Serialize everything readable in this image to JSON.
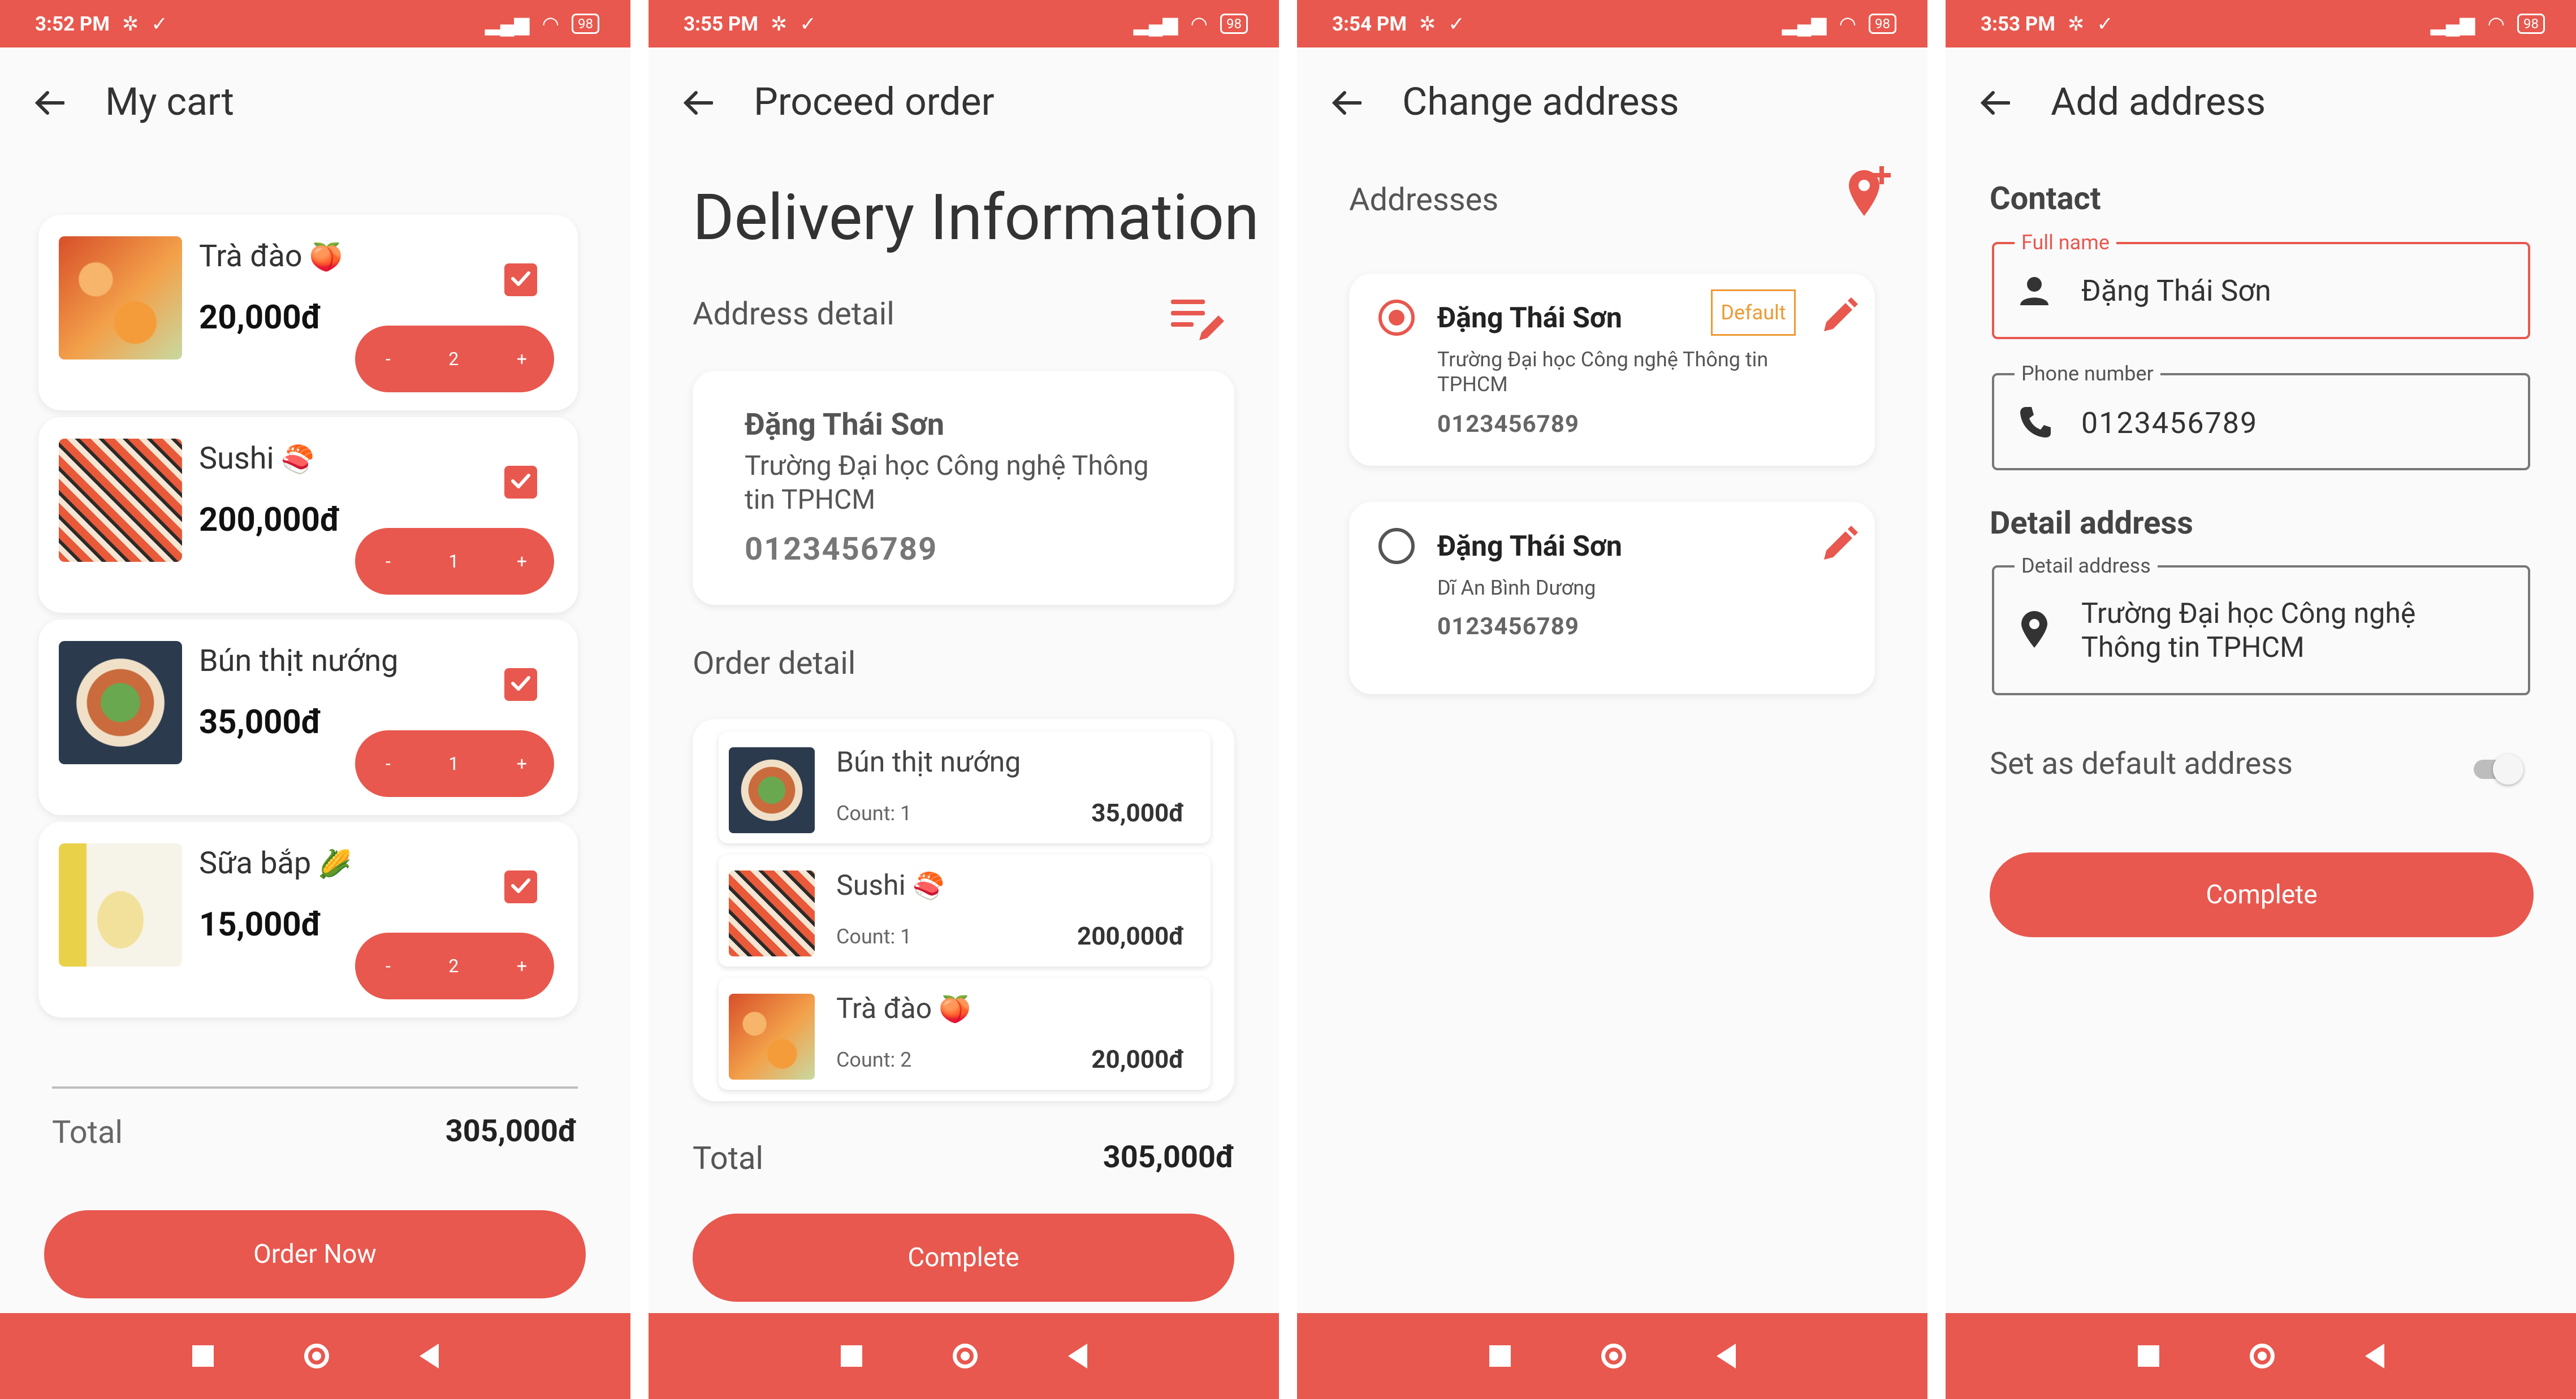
{
  "colors": {
    "accent": "#E8584E",
    "text": "#333333",
    "muted": "#666666",
    "default_badge": "#EF9A34"
  },
  "status_bars": [
    {
      "time": "3:52 PM",
      "battery": "98"
    },
    {
      "time": "3:55 PM",
      "battery": "98"
    },
    {
      "time": "3:54 PM",
      "battery": "98"
    },
    {
      "time": "3:53 PM",
      "battery": "98"
    }
  ],
  "cart": {
    "title": "My cart",
    "items": [
      {
        "name": "Trà đào",
        "emoji": "🍑",
        "price": "20,000đ",
        "qty": "2",
        "minus": "-",
        "plus": "+",
        "image": "peach-tea-photo",
        "checked": true
      },
      {
        "name": "Sushi",
        "emoji": "🍣",
        "price": "200,000đ",
        "qty": "1",
        "minus": "-",
        "plus": "+",
        "image": "sushi-photo",
        "checked": true
      },
      {
        "name": "Bún thịt nướng",
        "emoji": "",
        "price": "35,000đ",
        "qty": "1",
        "minus": "-",
        "plus": "+",
        "image": "noodle-bowl-photo",
        "checked": true
      },
      {
        "name": "Sữa bắp",
        "emoji": "🌽",
        "price": "15,000đ",
        "qty": "2",
        "minus": "-",
        "plus": "+",
        "image": "corn-milk-photo",
        "checked": true
      }
    ],
    "total_label": "Total",
    "total_value": "305,000đ",
    "order_button": "Order Now"
  },
  "proceed": {
    "title": "Proceed order",
    "heading": "Delivery Information",
    "address_label": "Address detail",
    "address": {
      "name": "Đặng Thái Sơn",
      "line": "Trường Đại học Công nghệ Thông tin TPHCM",
      "phone": "0123456789"
    },
    "order_label": "Order detail",
    "items": [
      {
        "name": "Bún thịt nướng",
        "emoji": "",
        "count": "Count: 1",
        "price": "35,000đ",
        "image": "noodle-bowl-photo"
      },
      {
        "name": "Sushi",
        "emoji": "🍣",
        "count": "Count: 1",
        "price": "200,000đ",
        "image": "sushi-photo"
      },
      {
        "name": "Trà đào",
        "emoji": "🍑",
        "count": "Count: 2",
        "price": "20,000đ",
        "image": "peach-tea-photo"
      }
    ],
    "total_label": "Total",
    "total_value": "305,000đ",
    "complete_button": "Complete"
  },
  "change_address": {
    "title": "Change address",
    "section_label": "Addresses",
    "addresses": [
      {
        "name": "Đặng Thái Sơn",
        "line": "Trường Đại học Công nghệ Thông tin TPHCM",
        "phone": "0123456789",
        "badge": "Default",
        "selected": true
      },
      {
        "name": "Đặng Thái Sơn",
        "line": "Dĩ An Bình Dương",
        "phone": "0123456789",
        "badge": "",
        "selected": false
      }
    ]
  },
  "add_address": {
    "title": "Add address",
    "contact_label": "Contact",
    "full_name": {
      "legend": "Full name",
      "value": "Đặng Thái Sơn"
    },
    "phone": {
      "legend": "Phone number",
      "value": "0123456789"
    },
    "detail_label": "Detail address",
    "detail": {
      "legend": "Detail address",
      "value": "Trường Đại học Công nghệ Thông tin TPHCM"
    },
    "default_label": "Set as default address",
    "default_on": false,
    "complete_button": "Complete"
  }
}
